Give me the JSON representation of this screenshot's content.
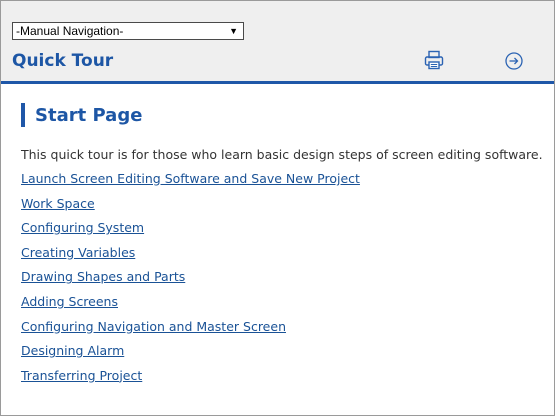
{
  "navigation": {
    "selected": "-Manual Navigation-",
    "arrow_icon": "triangle-down-icon"
  },
  "header": {
    "title": "Quick Tour",
    "print_icon": "printer-icon",
    "next_icon": "circle-arrow-right-icon"
  },
  "colors": {
    "accent": "#1f57a8",
    "title": "#1d56a5",
    "link": "#1a5296",
    "header_bg": "#efefef",
    "text": "#333333"
  },
  "main": {
    "section_title": "Start Page",
    "intro": "This quick tour is for those who learn basic design steps of screen editing software.",
    "links": [
      "Launch Screen Editing Software and Save New Project",
      "Work Space",
      "Configuring System",
      "Creating Variables",
      "Drawing Shapes and Parts",
      "Adding Screens",
      "Configuring Navigation and Master Screen",
      "Designing Alarm",
      "Transferring Project"
    ]
  }
}
